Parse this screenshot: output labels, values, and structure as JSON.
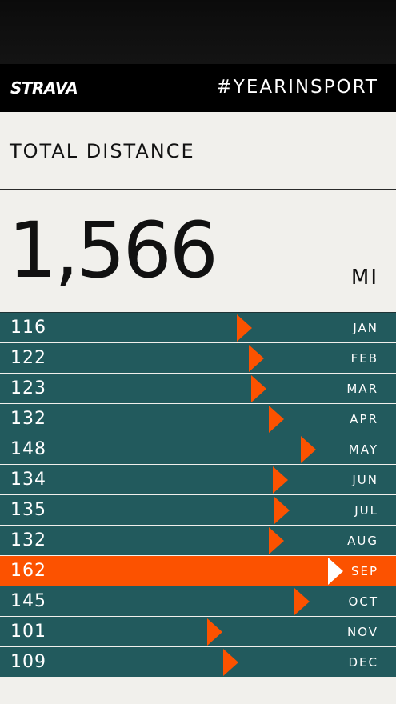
{
  "header": {
    "logo": "STRAVA",
    "hashtag": "#YEARINSPORT"
  },
  "stat": {
    "title": "TOTAL DISTANCE",
    "value": "1,566",
    "unit": "MI"
  },
  "colors": {
    "bar": "#225a5d",
    "accent": "#fc5200",
    "background": "#f1f0ec"
  },
  "months": [
    {
      "value": "116",
      "label": "JAN",
      "fraction": 0.716,
      "highlight": false
    },
    {
      "value": "122",
      "label": "FEB",
      "fraction": 0.753,
      "highlight": false
    },
    {
      "value": "123",
      "label": "MAR",
      "fraction": 0.759,
      "highlight": false
    },
    {
      "value": "132",
      "label": "APR",
      "fraction": 0.815,
      "highlight": false
    },
    {
      "value": "148",
      "label": "MAY",
      "fraction": 0.914,
      "highlight": false
    },
    {
      "value": "134",
      "label": "JUN",
      "fraction": 0.827,
      "highlight": false
    },
    {
      "value": "135",
      "label": "JUL",
      "fraction": 0.833,
      "highlight": false
    },
    {
      "value": "132",
      "label": "AUG",
      "fraction": 0.815,
      "highlight": false
    },
    {
      "value": "162",
      "label": "SEP",
      "fraction": 1.0,
      "highlight": true
    },
    {
      "value": "145",
      "label": "OCT",
      "fraction": 0.895,
      "highlight": false
    },
    {
      "value": "101",
      "label": "NOV",
      "fraction": 0.623,
      "highlight": false
    },
    {
      "value": "109",
      "label": "DEC",
      "fraction": 0.673,
      "highlight": false
    }
  ]
}
